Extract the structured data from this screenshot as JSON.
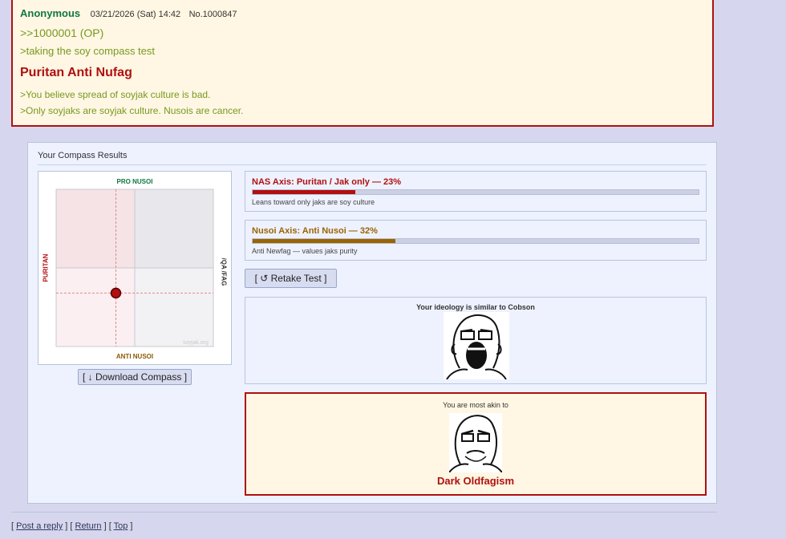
{
  "post": {
    "name": "Anonymous",
    "date": "03/21/2026 (Sat) 14:42",
    "number": "No.1000847",
    "reply_link": ">>1000001 (OP)",
    "greentext_1": ">taking the soy compass test",
    "result_title": "Puritan Anti Nufag",
    "greentext_2": ">You believe spread of soyjak culture is bad.",
    "greentext_3": ">Only soyjaks are soyjak culture. Nusois are cancer."
  },
  "results": {
    "title": "Your Compass Results",
    "compass": {
      "label_top": "PRO NUSOI",
      "label_bottom": "ANTI NUSOI",
      "label_left": "PURITAN",
      "label_right": "/QA /FAG",
      "watermark": "soyjak.org",
      "point_x_fraction": 0.38,
      "point_y_fraction": 0.66,
      "point_color": "#b01010"
    },
    "download_button": "[ ↓ Download Compass ]",
    "axes": [
      {
        "title": "NAS Axis: Puritan / Jak only — 23%",
        "percent": 23,
        "color": "#b01010",
        "description": "Leans toward only jaks are soy culture"
      },
      {
        "title": "Nusoi Axis: Anti Nusoi — 32%",
        "percent": 32,
        "color": "#9a6400",
        "description": "Anti Newfag — values jaks purity"
      }
    ],
    "retake_button": "[ ↺ Retake Test ]",
    "similar_label": "Your ideology is similar to Cobson",
    "akin_label": "You are most akin to",
    "akin_result": "Dark Oldfagism"
  },
  "footer": {
    "post_reply": "Post a reply",
    "return": "Return",
    "top": "Top"
  }
}
